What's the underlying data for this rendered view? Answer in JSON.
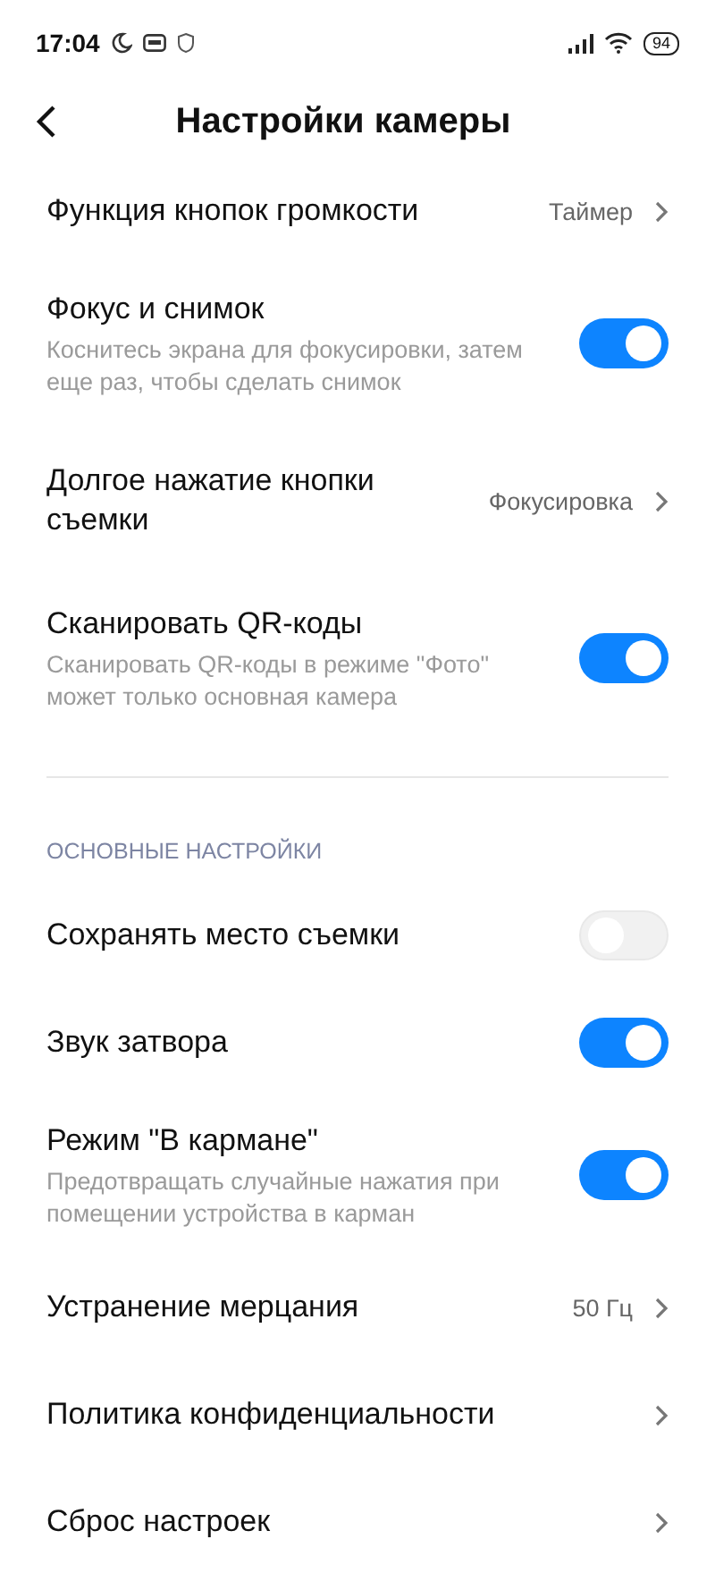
{
  "status_bar": {
    "time": "17:04",
    "battery": "94"
  },
  "header": {
    "title": "Настройки камеры"
  },
  "sections": [
    {
      "items": [
        {
          "kind": "link",
          "title": "Функция кнопок громкости",
          "value": "Таймер"
        },
        {
          "kind": "toggle",
          "title": "Фокус и снимок",
          "subtitle": "Коснитесь экрана для фокусировки, затем еще раз, чтобы сделать снимок",
          "on": true
        },
        {
          "kind": "link",
          "title": "Долгое нажатие кнопки съемки",
          "value": "Фокусировка"
        },
        {
          "kind": "toggle",
          "title": "Сканировать QR-коды",
          "subtitle": "Сканировать QR-коды в режиме \"Фото\" может только основная камера",
          "on": true
        }
      ]
    },
    {
      "heading": "ОСНОВНЫЕ НАСТРОЙКИ",
      "items": [
        {
          "kind": "toggle",
          "title": "Сохранять место съемки",
          "on": false
        },
        {
          "kind": "toggle",
          "title": "Звук затвора",
          "on": true
        },
        {
          "kind": "toggle",
          "title": "Режим \"В кармане\"",
          "subtitle": "Предотвращать случайные нажатия при помещении устройства в карман",
          "on": true
        },
        {
          "kind": "link",
          "title": "Устранение мерцания",
          "value": "50 Гц"
        },
        {
          "kind": "link",
          "title": "Политика конфиденциальности"
        },
        {
          "kind": "link",
          "title": "Сброс настроек"
        }
      ]
    }
  ]
}
